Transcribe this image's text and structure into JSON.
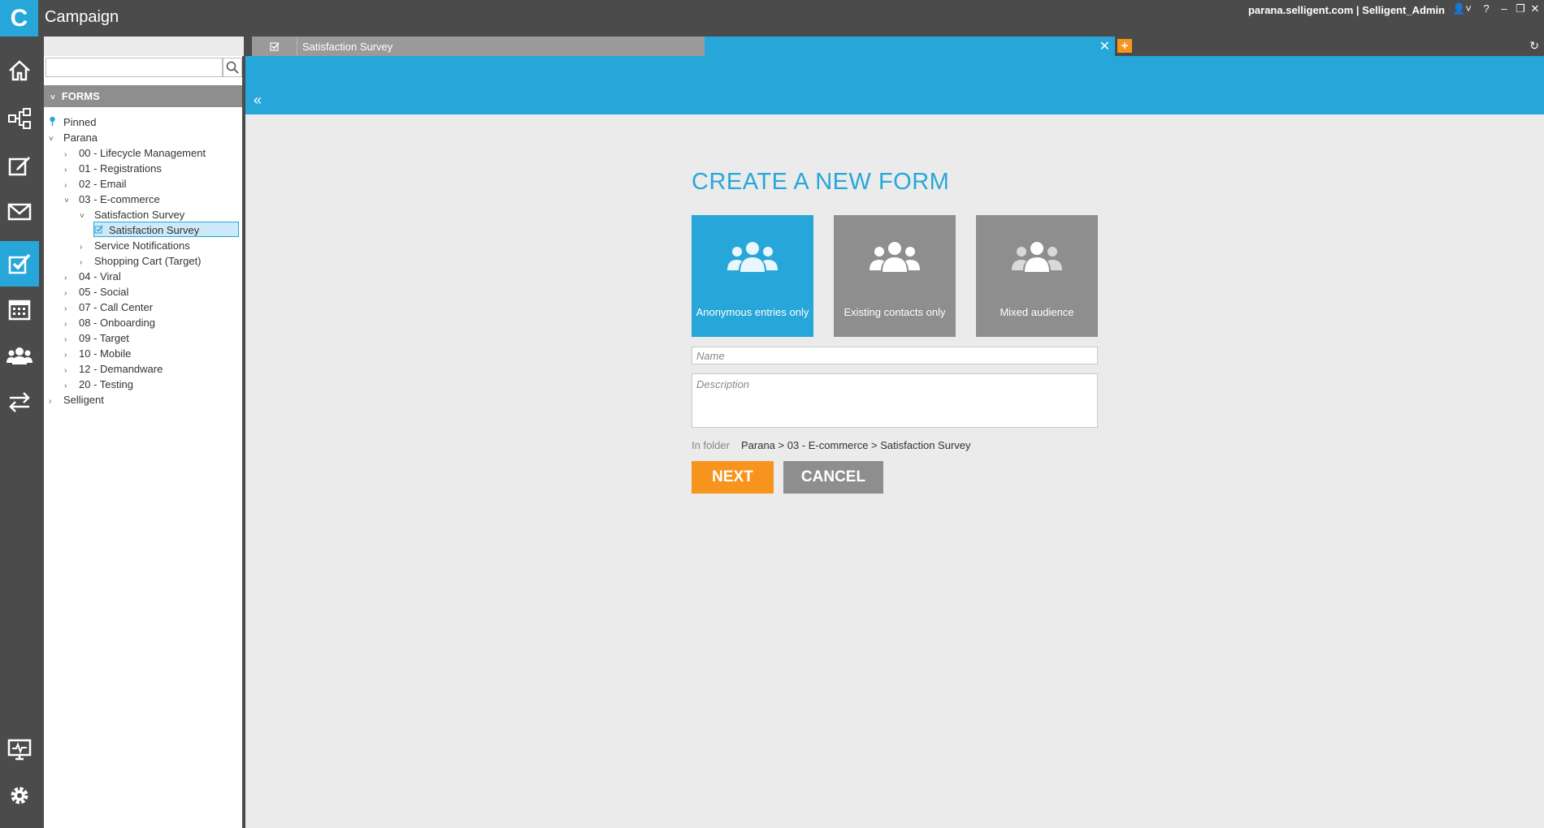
{
  "app": {
    "logo_letter": "C",
    "title": "Campaign",
    "account": "parana.selligent.com | Selligent_Admin"
  },
  "window_controls": {
    "user": "👤˅",
    "help": "?",
    "minimize": "–",
    "maximize": "❐",
    "close": "✕"
  },
  "tabs": {
    "doc_tab_label": "Satisfaction Survey",
    "close": "✕",
    "add": "+",
    "refresh": "↻"
  },
  "rail": {
    "items": [
      "home",
      "journey",
      "editor",
      "email",
      "forms",
      "calendar",
      "audience",
      "sync",
      "monitor",
      "settings"
    ],
    "active": "forms",
    "accent": "#27a7d9"
  },
  "tree": {
    "search_placeholder": "",
    "section_title": "FORMS",
    "items": [
      {
        "label": "Pinned",
        "level": 0,
        "arrow": "",
        "icon": "pin"
      },
      {
        "label": "Parana",
        "level": 0,
        "arrow": "˅"
      },
      {
        "label": "00 - Lifecycle Management",
        "level": 1,
        "arrow": "›"
      },
      {
        "label": "01 - Registrations",
        "level": 1,
        "arrow": "›"
      },
      {
        "label": "02 - Email",
        "level": 1,
        "arrow": "›"
      },
      {
        "label": "03 - E-commerce",
        "level": 1,
        "arrow": "˅"
      },
      {
        "label": "Satisfaction Survey",
        "level": 2,
        "arrow": "˅"
      },
      {
        "label": "Satisfaction Survey",
        "level": 3,
        "arrow": "",
        "icon": "form",
        "selected": true
      },
      {
        "label": "Service Notifications",
        "level": 2,
        "arrow": "›"
      },
      {
        "label": "Shopping Cart (Target)",
        "level": 2,
        "arrow": "›"
      },
      {
        "label": "04 - Viral",
        "level": 1,
        "arrow": "›"
      },
      {
        "label": "05 - Social",
        "level": 1,
        "arrow": "›"
      },
      {
        "label": "07 - Call Center",
        "level": 1,
        "arrow": "›"
      },
      {
        "label": "08 - Onboarding",
        "level": 1,
        "arrow": "›"
      },
      {
        "label": "09 - Target",
        "level": 1,
        "arrow": "›"
      },
      {
        "label": "10 - Mobile",
        "level": 1,
        "arrow": "›"
      },
      {
        "label": "12 - Demandware",
        "level": 1,
        "arrow": "›"
      },
      {
        "label": "20 - Testing",
        "level": 1,
        "arrow": "›"
      },
      {
        "label": "Selligent",
        "level": 0,
        "arrow": "›"
      }
    ]
  },
  "main": {
    "collapse": "«",
    "title": "CREATE A NEW FORM",
    "audience_options": [
      {
        "label": "Anonymous entries only",
        "selected": true
      },
      {
        "label": "Existing contacts only",
        "selected": false
      },
      {
        "label": "Mixed audience",
        "selected": false
      }
    ],
    "name_placeholder": "Name",
    "description_placeholder": "Description",
    "folder_label": "In folder",
    "folder_path": "Parana > 03 - E-commerce > Satisfaction Survey",
    "next_label": "NEXT",
    "cancel_label": "CANCEL"
  },
  "colors": {
    "accent": "#27a7d9",
    "primary_button": "#f7941d",
    "secondary_button": "#8e8e8e",
    "chrome": "#4b4b4b"
  }
}
